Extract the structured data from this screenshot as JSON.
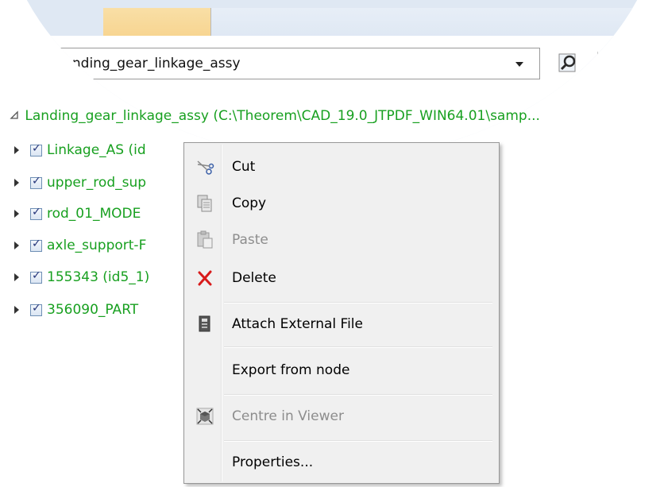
{
  "toolbar": {
    "combo_value": "Landing_gear_linkage_assy"
  },
  "tree": {
    "root_label": "Landing_gear_linkage_assy (C:\\Theorem\\CAD_19.0_JTPDF_WIN64.01\\samp...",
    "items": [
      {
        "label": "Linkage_AS (id"
      },
      {
        "label": "upper_rod_sup"
      },
      {
        "label": "rod_01_MODE"
      },
      {
        "label": "axle_support-F"
      },
      {
        "label": "155343 (id5_1)"
      },
      {
        "label": "356090_PART"
      }
    ]
  },
  "context_menu": {
    "items": [
      {
        "label": "Cut",
        "icon": "scissors-icon",
        "enabled": true
      },
      {
        "label": "Copy",
        "icon": "copy-icon",
        "enabled": true
      },
      {
        "label": "Paste",
        "icon": "paste-icon",
        "enabled": false
      },
      {
        "label": "Delete",
        "icon": "delete-x-icon",
        "enabled": true
      },
      {
        "label": "Attach External File",
        "icon": "attach-file-icon",
        "enabled": true
      },
      {
        "label": "Export from node",
        "icon": "",
        "enabled": true
      },
      {
        "label": "Centre in Viewer",
        "icon": "centre-viewer-icon",
        "enabled": false
      },
      {
        "label": "Properties...",
        "icon": "",
        "enabled": true
      }
    ]
  },
  "colors": {
    "tree_text": "#18a020",
    "delete_icon": "#d81b1b",
    "menu_background": "#f0f0f0"
  }
}
